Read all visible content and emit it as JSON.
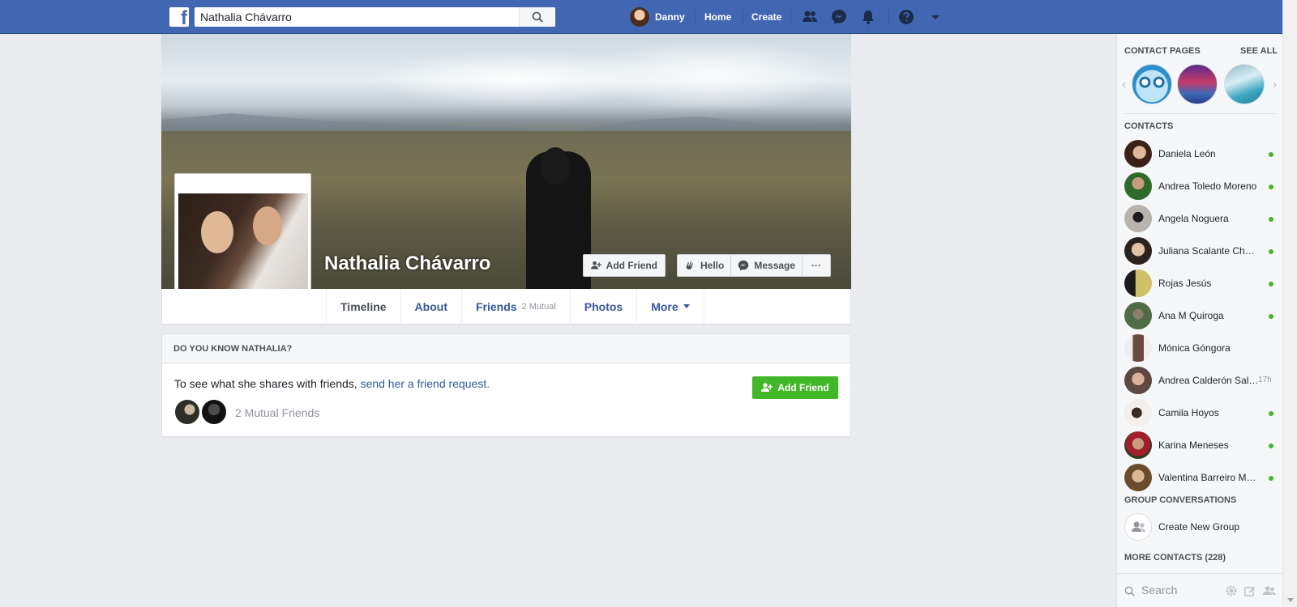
{
  "topbar": {
    "logo": "f",
    "search_value": "Nathalia Chávarro",
    "user_name": "Danny",
    "home": "Home",
    "create": "Create",
    "icons": [
      "friend-requests-icon",
      "messenger-icon",
      "notifications-icon",
      "help-icon",
      "account-menu-icon"
    ]
  },
  "profile": {
    "name": "Nathalia Chávarro",
    "buttons": {
      "add_friend": "Add Friend",
      "hello": "Hello",
      "message": "Message",
      "more": "···"
    },
    "tabs": [
      {
        "label": "Timeline"
      },
      {
        "label": "About"
      },
      {
        "label": "Friends",
        "sub": "2 Mutual"
      },
      {
        "label": "Photos"
      },
      {
        "label": "More"
      }
    ]
  },
  "know_box": {
    "title": "DO YOU KNOW NATHALIA?",
    "text": "To see what she shares with friends,",
    "link": "send her a friend request.",
    "button": "Add Friend",
    "mutual": "2 Mutual Friends"
  },
  "chat": {
    "contact_pages_label": "CONTACT PAGES",
    "see_all": "SEE ALL",
    "contacts_label": "CONTACTS",
    "contacts": [
      {
        "name": "Daniela León",
        "status": "online"
      },
      {
        "name": "Andrea Toledo Moreno",
        "status": "online"
      },
      {
        "name": "Angela Noguera",
        "status": "online"
      },
      {
        "name": "Juliana Scalante Chaparro",
        "status": "online"
      },
      {
        "name": "Rojas Jesús",
        "status": "online"
      },
      {
        "name": "Ana M Quiroga",
        "status": "online"
      },
      {
        "name": "Mónica Góngora",
        "status": ""
      },
      {
        "name": "Andrea Calderón Salazar",
        "status": "17h"
      },
      {
        "name": "Camila Hoyos",
        "status": "online"
      },
      {
        "name": "Karina Meneses",
        "status": "online"
      },
      {
        "name": "Valentina Barreiro Medina",
        "status": "online"
      }
    ],
    "group_label": "GROUP CONVERSATIONS",
    "create_group": "Create New Group",
    "more_contacts": "MORE CONTACTS (228)",
    "search_placeholder": "Search"
  },
  "colors": {
    "brand_blue": "#4267b2",
    "link_blue": "#365899",
    "green": "#42b72a",
    "page_bg": "#e9ebee"
  }
}
